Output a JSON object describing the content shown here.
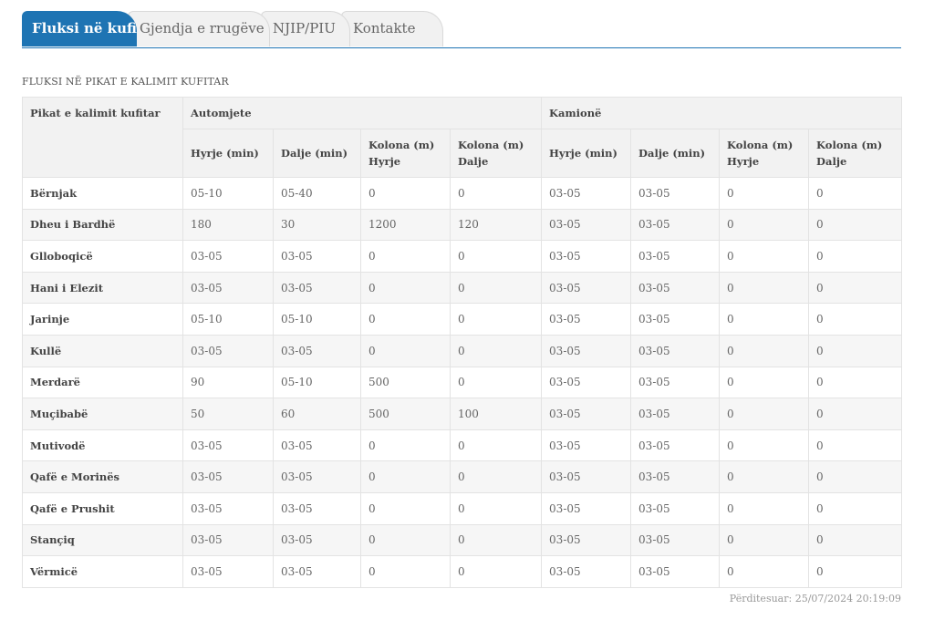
{
  "tabs": [
    {
      "label": "Fluksi në kufi",
      "active": true
    },
    {
      "label": "Gjendja e rrugëve",
      "active": false
    },
    {
      "label": "NJIP/PIU",
      "active": false
    },
    {
      "label": "Kontakte",
      "active": false
    }
  ],
  "section_title": "FLUKSI NË PIKAT E KALIMIT KUFITAR",
  "table": {
    "header_main": "Pikat e kalimit kufitar",
    "group_cars": "Automjete",
    "group_trucks": "Kamionë",
    "subheaders": [
      "Hyrje (min)",
      "Dalje (min)",
      "Kolona (m) Hyrje",
      "Kolona (m) Dalje",
      "Hyrje (min)",
      "Dalje (min)",
      "Kolona (m) Hyrje",
      "Kolona (m) Dalje"
    ],
    "rows": [
      [
        "Bërnjak",
        "05-10",
        "05-40",
        "0",
        "0",
        "03-05",
        "03-05",
        "0",
        "0"
      ],
      [
        "Dheu i Bardhë",
        "180",
        "30",
        "1200",
        "120",
        "03-05",
        "03-05",
        "0",
        "0"
      ],
      [
        "Glloboqicë",
        "03-05",
        "03-05",
        "0",
        "0",
        "03-05",
        "03-05",
        "0",
        "0"
      ],
      [
        "Hani i Elezit",
        "03-05",
        "03-05",
        "0",
        "0",
        "03-05",
        "03-05",
        "0",
        "0"
      ],
      [
        "Jarinje",
        "05-10",
        "05-10",
        "0",
        "0",
        "03-05",
        "03-05",
        "0",
        "0"
      ],
      [
        "Kullë",
        "03-05",
        "03-05",
        "0",
        "0",
        "03-05",
        "03-05",
        "0",
        "0"
      ],
      [
        "Merdarë",
        "90",
        "05-10",
        "500",
        "0",
        "03-05",
        "03-05",
        "0",
        "0"
      ],
      [
        "Muçibabë",
        "50",
        "60",
        "500",
        "100",
        "03-05",
        "03-05",
        "0",
        "0"
      ],
      [
        "Mutivodë",
        "03-05",
        "03-05",
        "0",
        "0",
        "03-05",
        "03-05",
        "0",
        "0"
      ],
      [
        "Qafë e Morinës",
        "03-05",
        "03-05",
        "0",
        "0",
        "03-05",
        "03-05",
        "0",
        "0"
      ],
      [
        "Qafë e Prushit",
        "03-05",
        "03-05",
        "0",
        "0",
        "03-05",
        "03-05",
        "0",
        "0"
      ],
      [
        "Stançiq",
        "03-05",
        "03-05",
        "0",
        "0",
        "03-05",
        "03-05",
        "0",
        "0"
      ],
      [
        "Vërmicë",
        "03-05",
        "03-05",
        "0",
        "0",
        "03-05",
        "03-05",
        "0",
        "0"
      ]
    ]
  },
  "updated": "Përditesuar: 25/07/2024 20:19:09",
  "colors": {
    "accent": "#1e74b3",
    "header_bg": "#f2f2f2",
    "stripe": "#f6f6f6"
  }
}
